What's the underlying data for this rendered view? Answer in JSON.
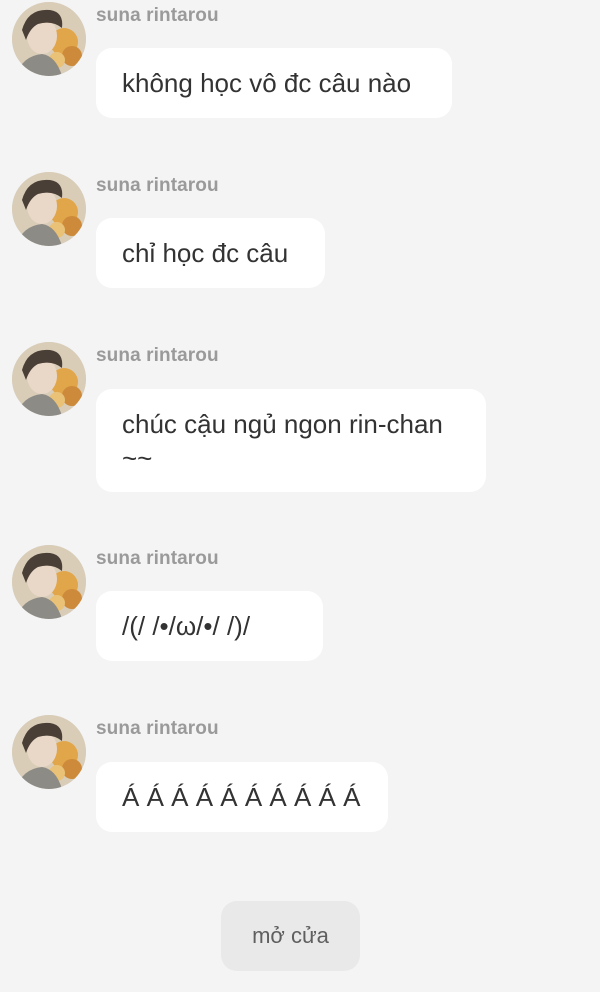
{
  "messages": [
    {
      "sender": "suna rintarou",
      "text": "không học vô đc câu nào"
    },
    {
      "sender": "suna rintarou",
      "text": "chỉ học đc câu"
    },
    {
      "sender": "suna rintarou",
      "text": "chúc cậu ngủ ngon rin-chan ~~"
    },
    {
      "sender": "suna rintarou",
      "text": "/(/ /•/ω/•/ /)/"
    },
    {
      "sender": "suna rintarou",
      "text": "Á Á Á Á Á Á Á Á Á Á"
    }
  ],
  "action": {
    "label": "mở cửa"
  },
  "colors": {
    "background": "#f4f4f4",
    "bubble": "#ffffff",
    "sender_name": "#9a9a9a",
    "message_text": "#333333",
    "action_button": "#e9e9e9"
  },
  "icons": {
    "avatar": "avatar-portrait-with-flowers"
  }
}
